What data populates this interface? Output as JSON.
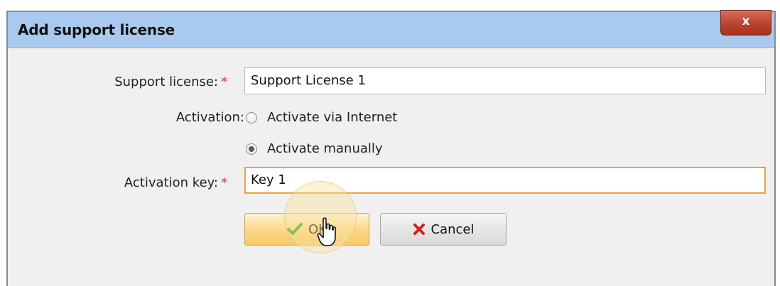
{
  "dialog": {
    "title": "Add support license",
    "close_label": "x"
  },
  "form": {
    "support_license": {
      "label": "Support license:",
      "required_mark": "*",
      "value": "Support License 1"
    },
    "activation": {
      "label": "Activation:",
      "options": [
        {
          "label": "Activate via Internet",
          "selected": false
        },
        {
          "label": "Activate manually",
          "selected": true
        }
      ]
    },
    "activation_key": {
      "label": "Activation key:",
      "required_mark": "*",
      "value": "Key 1",
      "focused": true
    }
  },
  "buttons": {
    "ok_label": "OK",
    "cancel_label": "Cancel"
  },
  "icons": {
    "ok": "checkmark-icon",
    "cancel": "x-mark-icon",
    "close": "close-icon",
    "cursor": "mouse-pointer-icon"
  },
  "colors": {
    "titlebar": "#a9c9ef",
    "close_button": "#b8432e",
    "required": "#d03030",
    "focus_border": "#e8a53a",
    "ok_button": "#fbd98b",
    "check_green": "#3aa12b",
    "cancel_x_red": "#d02020"
  }
}
